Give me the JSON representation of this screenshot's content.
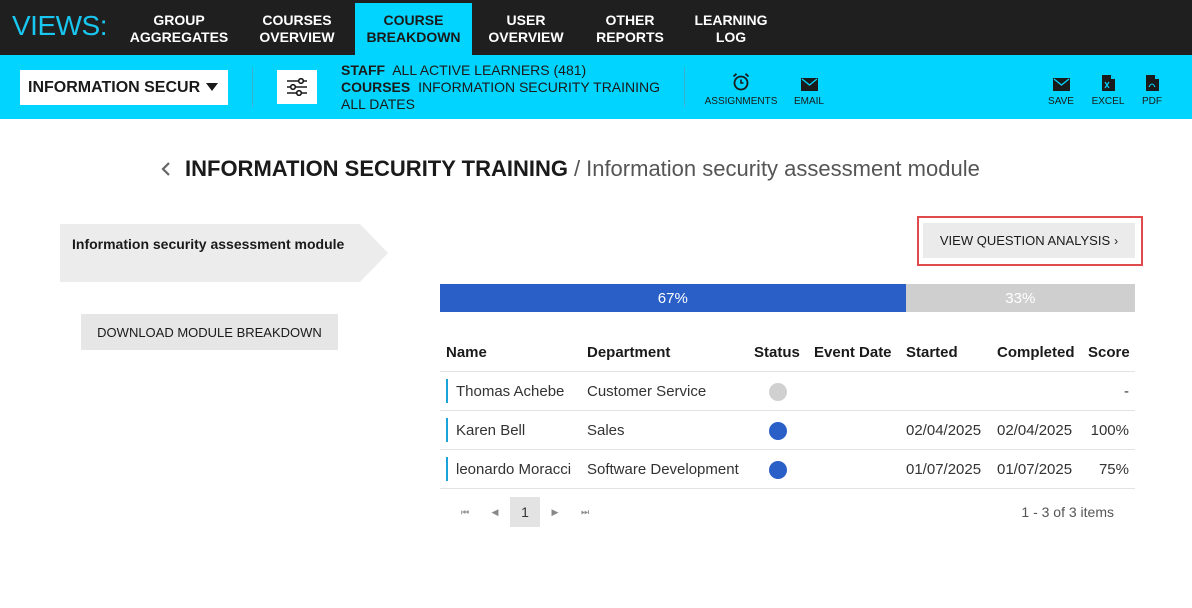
{
  "brand": "VIEWS:",
  "nav": {
    "tabs": [
      {
        "label": "GROUP\nAGGREGATES"
      },
      {
        "label": "COURSES\nOVERVIEW"
      },
      {
        "label": "COURSE\nBREAKDOWN"
      },
      {
        "label": "USER\nOVERVIEW"
      },
      {
        "label": "OTHER\nREPORTS"
      },
      {
        "label": "LEARNING\nLOG"
      }
    ],
    "active": "COURSE BREAKDOWN"
  },
  "toolbar": {
    "course_select": "INFORMATION SECUR",
    "filter": {
      "staff_label": "STAFF",
      "staff_value": "ALL ACTIVE LEARNERS (481)",
      "courses_label": "COURSES",
      "courses_value": "INFORMATION SECURITY TRAINING",
      "dates": "ALL DATES"
    },
    "assignments_label": "ASSIGNMENTS",
    "email_label": "EMAIL",
    "save_label": "SAVE",
    "excel_label": "EXCEL",
    "pdf_label": "PDF"
  },
  "heading": {
    "course": "INFORMATION SECURITY TRAINING",
    "separator": "/",
    "module": "Information security assessment module"
  },
  "module_tag": "Information security assessment module",
  "download_label": "DOWNLOAD MODULE BREAKDOWN",
  "question_analysis_label": "VIEW QUESTION ANALYSIS",
  "progress": {
    "completed_percent": 67,
    "completed_label": "67%",
    "remaining_label": "33%"
  },
  "table": {
    "headers": {
      "name": "Name",
      "department": "Department",
      "status": "Status",
      "event_date": "Event Date",
      "started": "Started",
      "completed": "Completed",
      "score": "Score"
    },
    "rows": [
      {
        "name": "Thomas Achebe",
        "department": "Customer Service",
        "status": "not-started",
        "event_date": "",
        "started": "",
        "completed": "",
        "score": "-"
      },
      {
        "name": "Karen Bell",
        "department": "Sales",
        "status": "completed",
        "event_date": "",
        "started": "02/04/2025",
        "completed": "02/04/2025",
        "score": "100%"
      },
      {
        "name": "leonardo Moracci",
        "department": "Software Development",
        "status": "completed",
        "event_date": "",
        "started": "01/07/2025",
        "completed": "01/07/2025",
        "score": "75%"
      }
    ]
  },
  "pager": {
    "current_page": "1",
    "info": "1 - 3 of 3 items"
  },
  "colors": {
    "accent": "#00d4ff",
    "status_completed": "#2a5fc8",
    "status_not_started": "#d0d0d0"
  }
}
